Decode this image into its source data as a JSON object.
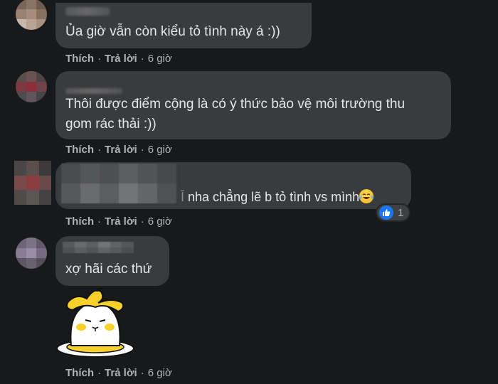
{
  "comments": [
    {
      "text": "Ủa giờ vẫn còn kiểu tỏ tình này á :))",
      "like": "Thích",
      "reply": "Trả lời",
      "time": "6 giờ"
    },
    {
      "text_line1": "Thôi được điểm cộng là có ý thức bảo vệ môi trường thu",
      "text_line2": "gom rác thải :))",
      "like": "Thích",
      "reply": "Trả lời",
      "time": "6 giờ"
    },
    {
      "text": "nha chẳng lẽ b tỏ tình vs mình",
      "reaction_count": "1",
      "like": "Thích",
      "reply": "Trả lời",
      "time": "6 giờ"
    },
    {
      "text": "xợ hãi các thứ",
      "like": "Thích",
      "reply": "Trả lời",
      "time": "6 giờ"
    }
  ],
  "icons": {
    "reaction": "like-icon",
    "emoji": "laughing-emoji-icon",
    "sticker": "banana-cat-sticker"
  },
  "colors": {
    "background": "#18191a",
    "bubble": "#3a3b3c",
    "text": "#e4e6eb",
    "secondary_text": "#b0b3b8",
    "like_blue": "#1877f2"
  }
}
